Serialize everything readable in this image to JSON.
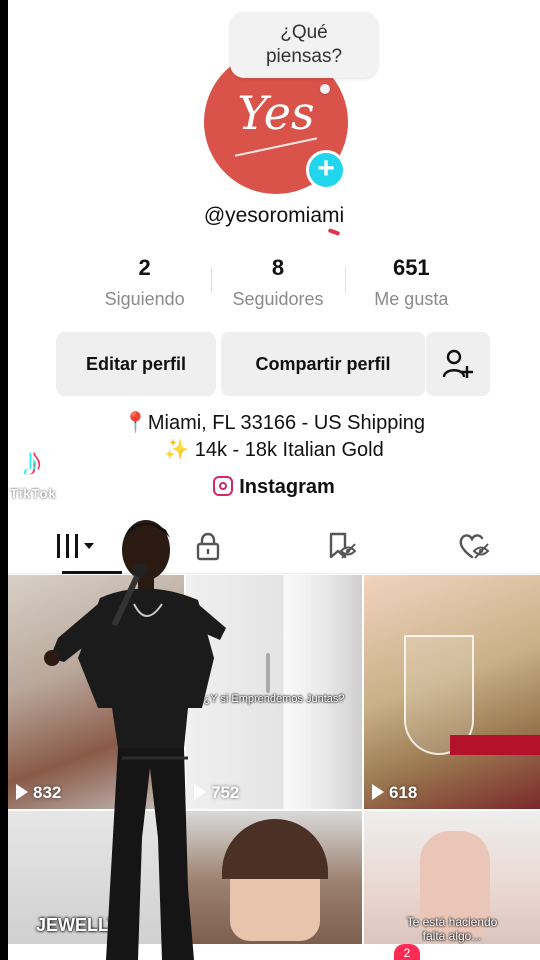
{
  "profile": {
    "bubble_text": "¿Qué piensas?",
    "avatar_logo": "Yes",
    "username": "@yesoromiami",
    "stats": [
      {
        "value": "2",
        "label": "Siguiendo"
      },
      {
        "value": "8",
        "label": "Seguidores"
      },
      {
        "value": "651",
        "label": "Me gusta"
      }
    ],
    "buttons": {
      "edit": "Editar perfil",
      "share": "Compartir perfil"
    },
    "bio": [
      "📍Miami, FL 33166 - US Shipping",
      "✨ 14k - 18k Italian Gold"
    ],
    "link_label": "Instagram"
  },
  "watermark": {
    "text": "TikTok"
  },
  "tabs": [
    {
      "icon": "videos-grid-icon",
      "active": true
    },
    {
      "icon": "lock-icon",
      "active": false
    },
    {
      "icon": "bookmark-hidden-icon",
      "active": false
    },
    {
      "icon": "heart-hidden-icon",
      "active": false
    }
  ],
  "videos": [
    {
      "views": "832"
    },
    {
      "views": "752",
      "caption": "¿Y si Emprendemos Juntas?"
    },
    {
      "views": "618"
    },
    {
      "caption": "JEWELLY"
    },
    {},
    {
      "caption": "Te está haciendo falta algo..."
    }
  ],
  "nav": {
    "inbox_badge": "2"
  },
  "colors": {
    "accent": "#20d5ec",
    "brand_red": "#d9534a",
    "badge_red": "#fe2c55"
  }
}
